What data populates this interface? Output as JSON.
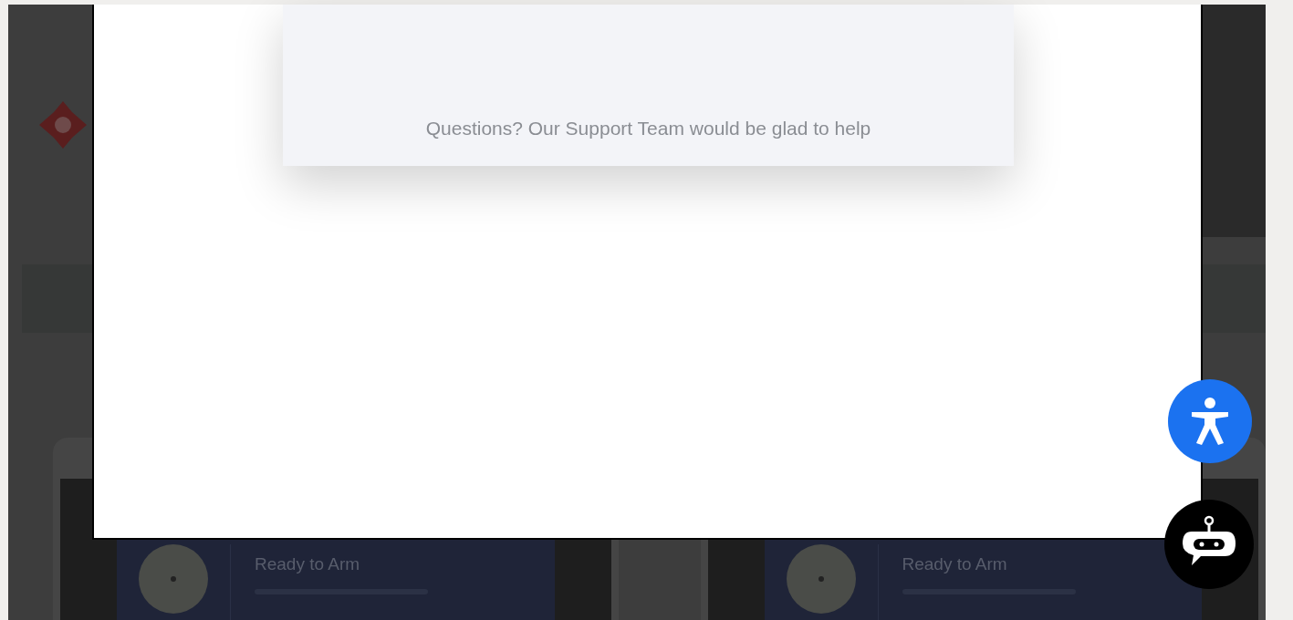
{
  "modal": {
    "support_text": "Questions? Our Support Team would be glad to help"
  },
  "background_cards": [
    {
      "title": "Ready to Arm"
    },
    {
      "title": "Ready to Arm"
    }
  ]
}
